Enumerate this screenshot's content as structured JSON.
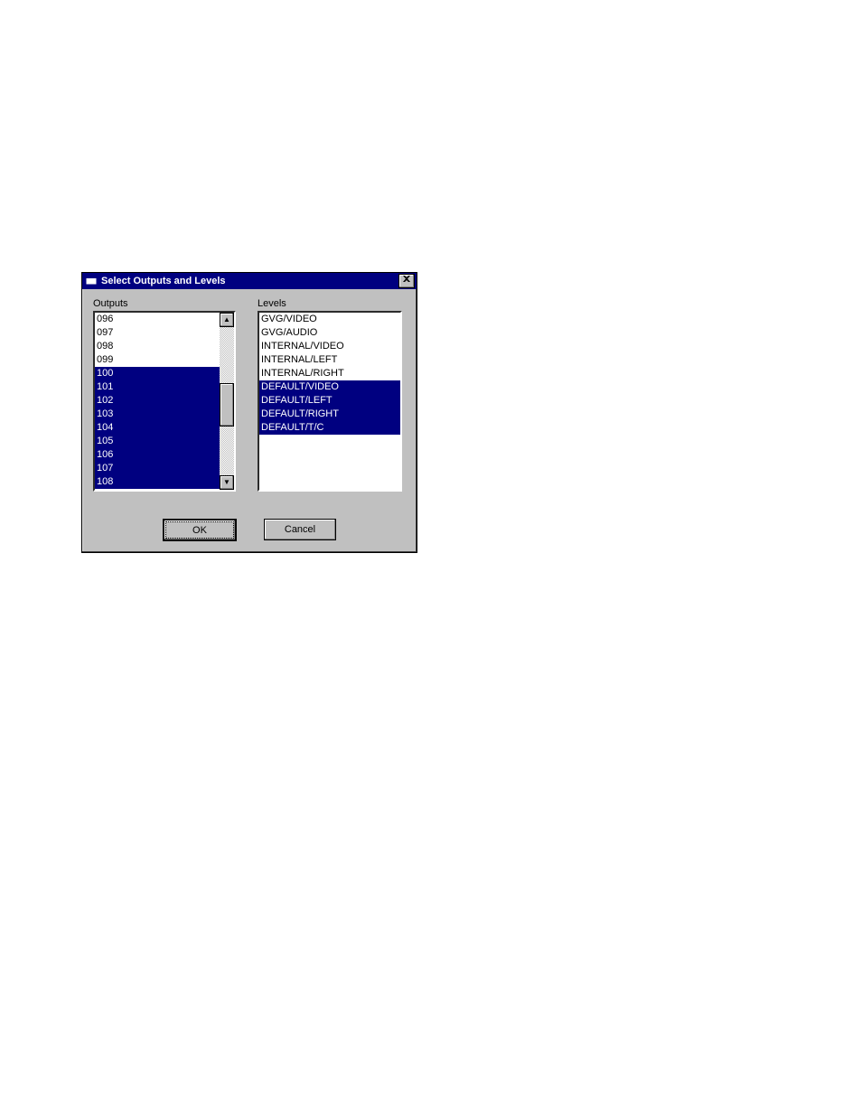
{
  "dialog": {
    "title": "Select Outputs and Levels",
    "close_label": "X"
  },
  "outputs": {
    "label": "Outputs",
    "items": [
      {
        "text": "096",
        "selected": false
      },
      {
        "text": "097",
        "selected": false
      },
      {
        "text": "098",
        "selected": false
      },
      {
        "text": "099",
        "selected": false
      },
      {
        "text": "100",
        "selected": true
      },
      {
        "text": "101",
        "selected": true
      },
      {
        "text": "102",
        "selected": true
      },
      {
        "text": "103",
        "selected": true
      },
      {
        "text": "104",
        "selected": true
      },
      {
        "text": "105",
        "selected": true
      },
      {
        "text": "106",
        "selected": true
      },
      {
        "text": "107",
        "selected": true
      },
      {
        "text": "108",
        "selected": true
      }
    ]
  },
  "levels": {
    "label": "Levels",
    "items": [
      {
        "text": "GVG/VIDEO",
        "selected": false
      },
      {
        "text": "GVG/AUDIO",
        "selected": false
      },
      {
        "text": "INTERNAL/VIDEO",
        "selected": false
      },
      {
        "text": "INTERNAL/LEFT",
        "selected": false
      },
      {
        "text": "INTERNAL/RIGHT",
        "selected": false
      },
      {
        "text": "DEFAULT/VIDEO",
        "selected": true
      },
      {
        "text": "DEFAULT/LEFT",
        "selected": true
      },
      {
        "text": "DEFAULT/RIGHT",
        "selected": true
      },
      {
        "text": "DEFAULT/T/C",
        "selected": true
      }
    ]
  },
  "buttons": {
    "ok": "OK",
    "cancel": "Cancel"
  }
}
